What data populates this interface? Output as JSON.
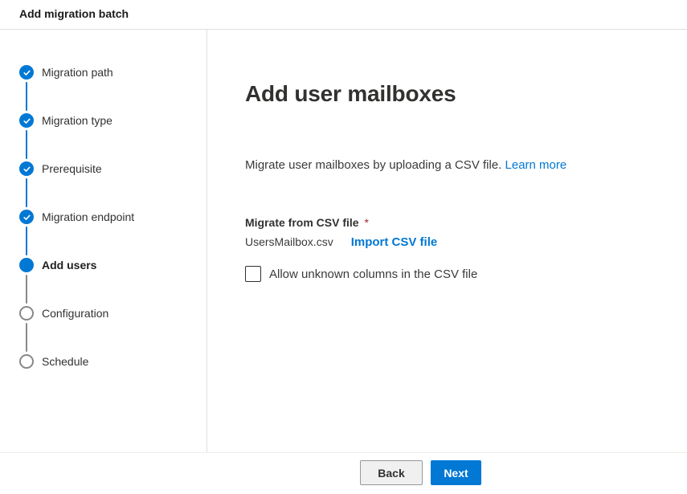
{
  "header": {
    "title": "Add migration batch"
  },
  "stepper": {
    "steps": [
      {
        "label": "Migration path",
        "state": "completed"
      },
      {
        "label": "Migration type",
        "state": "completed"
      },
      {
        "label": "Prerequisite",
        "state": "completed"
      },
      {
        "label": "Migration endpoint",
        "state": "completed"
      },
      {
        "label": "Add users",
        "state": "current"
      },
      {
        "label": "Configuration",
        "state": "upcoming"
      },
      {
        "label": "Schedule",
        "state": "upcoming"
      }
    ]
  },
  "main": {
    "heading": "Add user mailboxes",
    "description": "Migrate user mailboxes by uploading a CSV file.",
    "learn_more_label": "Learn more",
    "csv_field": {
      "label": "Migrate from CSV file",
      "required_marker": "*",
      "file_name": "UsersMailbox.csv",
      "import_link_label": "Import CSV file"
    },
    "checkbox": {
      "label": "Allow unknown columns in the CSV file",
      "checked": false
    }
  },
  "footer": {
    "back_label": "Back",
    "next_label": "Next"
  },
  "colors": {
    "accent": "#0078d4",
    "required_marker": "#a4262c",
    "divider": "#e1dfdd"
  },
  "icons": {
    "completed_step": "check-icon",
    "current_step": "filled-dot-icon",
    "upcoming_step": "outline-circle-icon"
  }
}
